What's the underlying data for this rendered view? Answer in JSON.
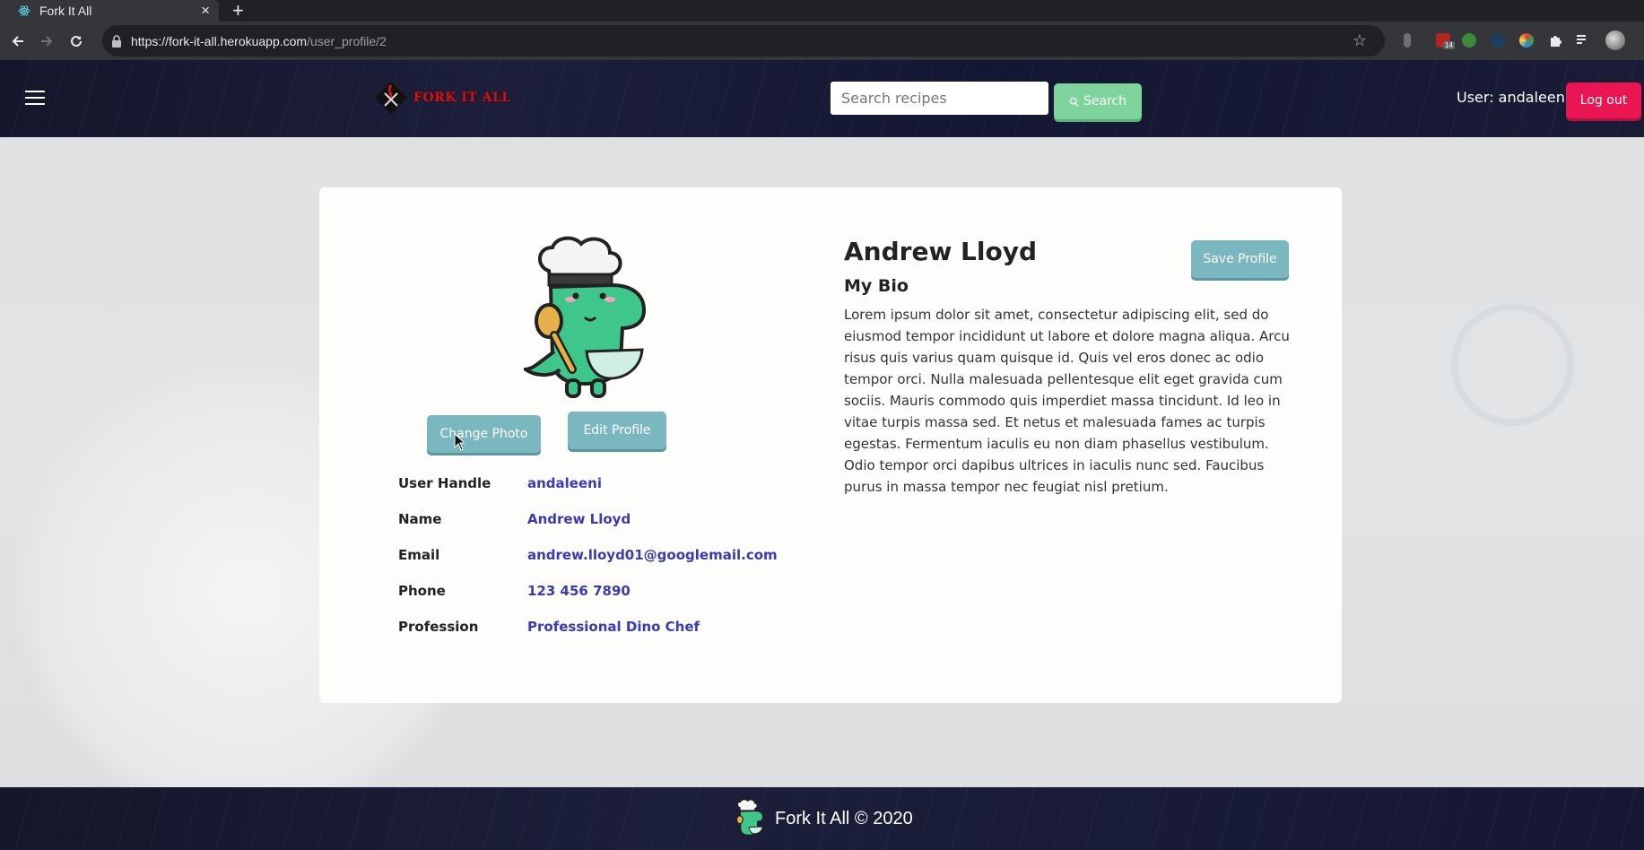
{
  "browser": {
    "tab_title": "Fork It All",
    "close_glyph": "×",
    "new_tab_glyph": "+",
    "url_host": "https://fork-it-all.herokuapp.com",
    "url_path": "/user_profile/2",
    "extension_badge": "14"
  },
  "header": {
    "logo_text": "FORK IT ALL",
    "search_placeholder": "Search recipes",
    "search_label": "Search",
    "user_label": "User: andaleeni",
    "logout_label": "Log out"
  },
  "profile": {
    "change_photo_label": "Change Photo",
    "edit_profile_label": "Edit Profile",
    "save_profile_label": "Save Profile",
    "name": "Andrew Lloyd",
    "bio_heading": "My Bio",
    "bio": "Lorem ipsum dolor sit amet, consectetur adipiscing elit, sed do eiusmod tempor incididunt ut labore et dolore magna aliqua. Arcu risus quis varius quam quisque id. Quis vel eros donec ac odio tempor orci. Nulla malesuada pellentesque elit eget gravida cum sociis. Mauris commodo quis imperdiet massa tincidunt. Id leo in vitae turpis massa sed. Et netus et malesuada fames ac turpis egestas. Fermentum iaculis eu non diam phasellus vestibulum. Odio tempor orci dapibus ultrices in iaculis nunc sed. Faucibus purus in massa tempor nec feugiat nisl pretium.",
    "fields": [
      {
        "label": "User Handle",
        "value": "andaleeni"
      },
      {
        "label": "Name",
        "value": "Andrew Lloyd"
      },
      {
        "label": "Email",
        "value": "andrew.lloyd01@googlemail.com"
      },
      {
        "label": "Phone",
        "value": "123 456 7890"
      },
      {
        "label": "Profession",
        "value": "Professional Dino Chef"
      }
    ]
  },
  "footer": {
    "text": "Fork It All © 2020"
  },
  "colors": {
    "header_bg": "#1c1f3a",
    "search_button": "#7ed49b",
    "logout_button": "#ea1553",
    "teal_button": "#7ab7bf",
    "value_text": "#3a3bb0"
  },
  "icons": [
    "react-favicon",
    "back-arrow-icon",
    "forward-arrow-icon",
    "reload-icon",
    "lock-icon",
    "star-icon",
    "hamburger-icon",
    "search-icon",
    "dino-chef-avatar",
    "puzzle-icon",
    "mouse-cursor"
  ]
}
